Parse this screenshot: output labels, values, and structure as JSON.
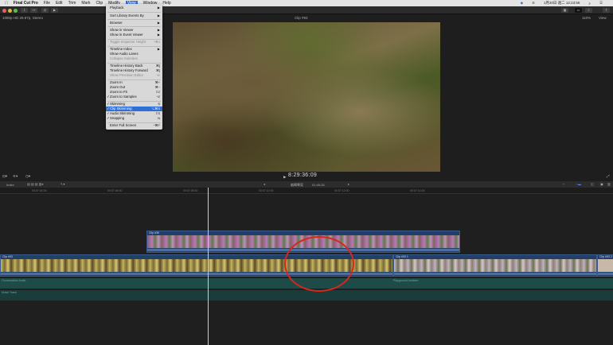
{
  "menubar": {
    "apple": "",
    "app": "Final Cut Pro",
    "items": [
      "File",
      "Edit",
      "Trim",
      "Mark",
      "Clip",
      "Modify",
      "View",
      "Window",
      "Help"
    ],
    "active": "View",
    "status": {
      "date": "1月20日 週二 12:23:59"
    }
  },
  "viewer": {
    "format": "1080p HD 29.97p, Stereo",
    "clip_title": "Clip #93",
    "zoom": "110%",
    "view_label": "View",
    "timecode": "8:29:36:09"
  },
  "timeline_header": {
    "index_label": "Index",
    "project": "編輯專案",
    "duration": "01:46:28"
  },
  "ruler": [
    "00:07:04:00",
    "00:07:06:00",
    "00:07:08:00",
    "00:07:10:00",
    "00:07:12:00",
    "00:07:14:00"
  ],
  "clips": {
    "connected": "Clip #36",
    "primary1": "Clip #93",
    "primary2": "Clip #93 1",
    "primary3": "Clip #93 2"
  },
  "audio": {
    "lane1": "Conversation Audio",
    "lane2": "Playground Ambient",
    "lane3": "Music Track"
  },
  "view_menu": [
    {
      "label": "Playback",
      "key": "▶"
    },
    {
      "label": "Sort Library Events By",
      "key": "▶"
    },
    {
      "label": "Browser",
      "key": "▶"
    },
    {
      "label": "Show in Viewer",
      "key": "▶"
    },
    {
      "label": "Show in Event Viewer",
      "key": "▶"
    },
    {
      "label": "Toggle Inspector Height",
      "key": "^⌘4",
      "disabled": true
    },
    {
      "label": "Timeline Index",
      "key": "▶"
    },
    {
      "label": "Show Audio Lanes",
      "key": ""
    },
    {
      "label": "Collapse Subroles",
      "key": "",
      "disabled": true
    },
    {
      "label": "Timeline History Back",
      "key": "⌘["
    },
    {
      "label": "Timeline History Forward",
      "key": "⌘]"
    },
    {
      "label": "Show Precision Editor",
      "key": "^E",
      "disabled": true
    },
    {
      "label": "Zoom In",
      "key": "⌘+"
    },
    {
      "label": "Zoom Out",
      "key": "⌘−"
    },
    {
      "label": "Zoom to Fit",
      "key": "⇧Z"
    },
    {
      "label": "Zoom to Samples",
      "key": "^Z",
      "checked": true
    },
    {
      "label": "Skimming",
      "key": "S",
      "checked": true
    },
    {
      "label": "Clip Skimming",
      "key": "⌥⌘S",
      "checked": true,
      "highlighted": true
    },
    {
      "label": "Audio Skimming",
      "key": "⇧S",
      "checked": true
    },
    {
      "label": "Snapping",
      "key": "N",
      "checked": true
    },
    {
      "label": "Enter Full Screen",
      "key": "^⌘F"
    }
  ],
  "colors": {
    "accent": "#2f6fd6",
    "annotation": "#d8261c"
  }
}
